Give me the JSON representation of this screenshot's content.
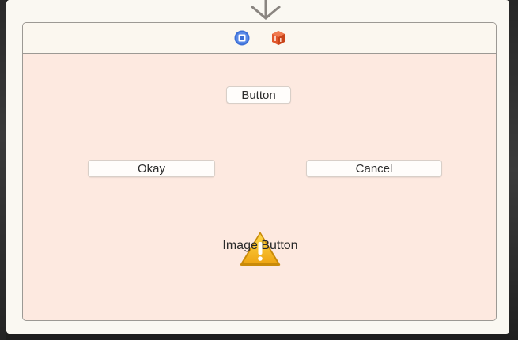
{
  "scene": {
    "dock": {
      "icons": [
        "view-controller-icon",
        "first-responder-cube-icon"
      ]
    },
    "buttons": {
      "main_label": "Button",
      "okay_label": "Okay",
      "cancel_label": "Cancel",
      "image_button_label": "Image Button"
    },
    "image_button_icon": "warning-icon"
  },
  "colors": {
    "canvas_background": "#fde9e0",
    "frame_background": "#faf8f2",
    "view_controller_icon": "#3c6fd6",
    "cube_icon": "#e0562b",
    "warning_yellow": "#f2b81a"
  }
}
